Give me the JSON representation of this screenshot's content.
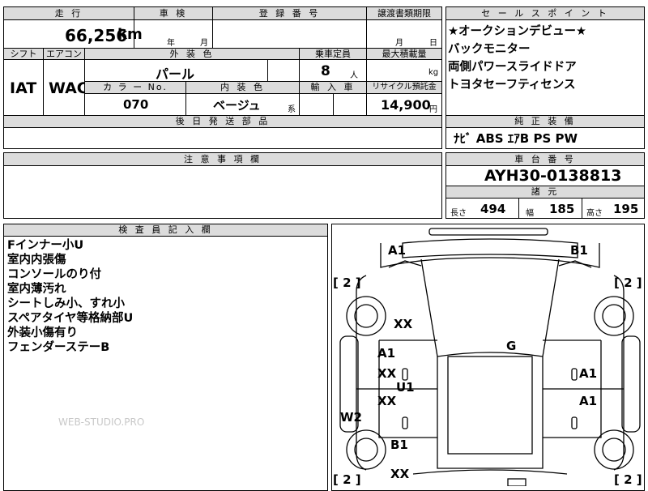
{
  "headers": {
    "mileage": "走 行",
    "inspection": "車 検",
    "registration": "登 録 番 号",
    "transfer_deadline": "譲渡書類期限",
    "sales_points": "セ ー ル ス ポ イ ン ト",
    "shift": "シフト",
    "aircon": "エアコン",
    "exterior_color": "外 装 色",
    "capacity": "乗車定員",
    "max_load": "最大積載量",
    "color_no": "カ ラ ー No.",
    "interior_color": "内 装 色",
    "import": "輸 入 車",
    "recycle_fee": "リサイクル預託金",
    "later_parts": "後 日 発 送 部 品",
    "genuine_equipment": "純 正 装 備",
    "notes": "注 意 事 項 欄",
    "chassis_no": "車 台 番 号",
    "specs": "諸 元",
    "inspector_notes": "検 査 員 記 入 欄"
  },
  "values": {
    "mileage": "66,256",
    "mileage_unit": "km",
    "inspection_year": "年",
    "inspection_month": "月",
    "transfer_month": "月",
    "transfer_day": "日",
    "shift": "IAT",
    "aircon": "WAC",
    "exterior_color": "パール",
    "capacity": "8",
    "capacity_unit": "人",
    "max_load_unit": "kg",
    "color_no": "070",
    "interior_color": "ベージュ",
    "interior_suffix": "系",
    "recycle_fee": "14,900",
    "recycle_unit": "円",
    "genuine_equipment": "ﾅﾋﾞ ABS ｴｱB PS PW",
    "chassis_no": "AYH30-0138813",
    "length_label": "長さ",
    "length": "494",
    "width_label": "幅",
    "width": "185",
    "height_label": "高さ",
    "height": "195"
  },
  "sales_points": [
    "★オークションデビュー★",
    "バックモニター",
    "両側パワースライドドア",
    "トヨタセーフティセンス"
  ],
  "inspector_notes": [
    "Fインナー小U",
    "室内内張傷",
    "コンソールのり付",
    "室内薄汚れ",
    "シートしみ小、すれ小",
    "スペアタイヤ等格納部U",
    "外装小傷有り",
    "フェンダーステーB"
  ],
  "watermark": "WEB-STUDIO.PRO",
  "damage_marks": {
    "front_left_corner": "A1",
    "front_right_corner": "B1",
    "tire_fl": "[ 2 ]",
    "tire_fr": "[ 2 ]",
    "tire_rl": "[ 2 ]",
    "tire_rr": "[ 2 ]",
    "left_fender": "XX",
    "left_front_door_a": "A1",
    "left_front_door_x": "XX",
    "left_pillar": "U1",
    "left_rear_door": "XX",
    "left_rocker": "W2",
    "left_quarter": "B1",
    "left_rear_bumper": "XX",
    "roof": "G",
    "right_front_door": "A1",
    "right_rear_door": "A1"
  }
}
